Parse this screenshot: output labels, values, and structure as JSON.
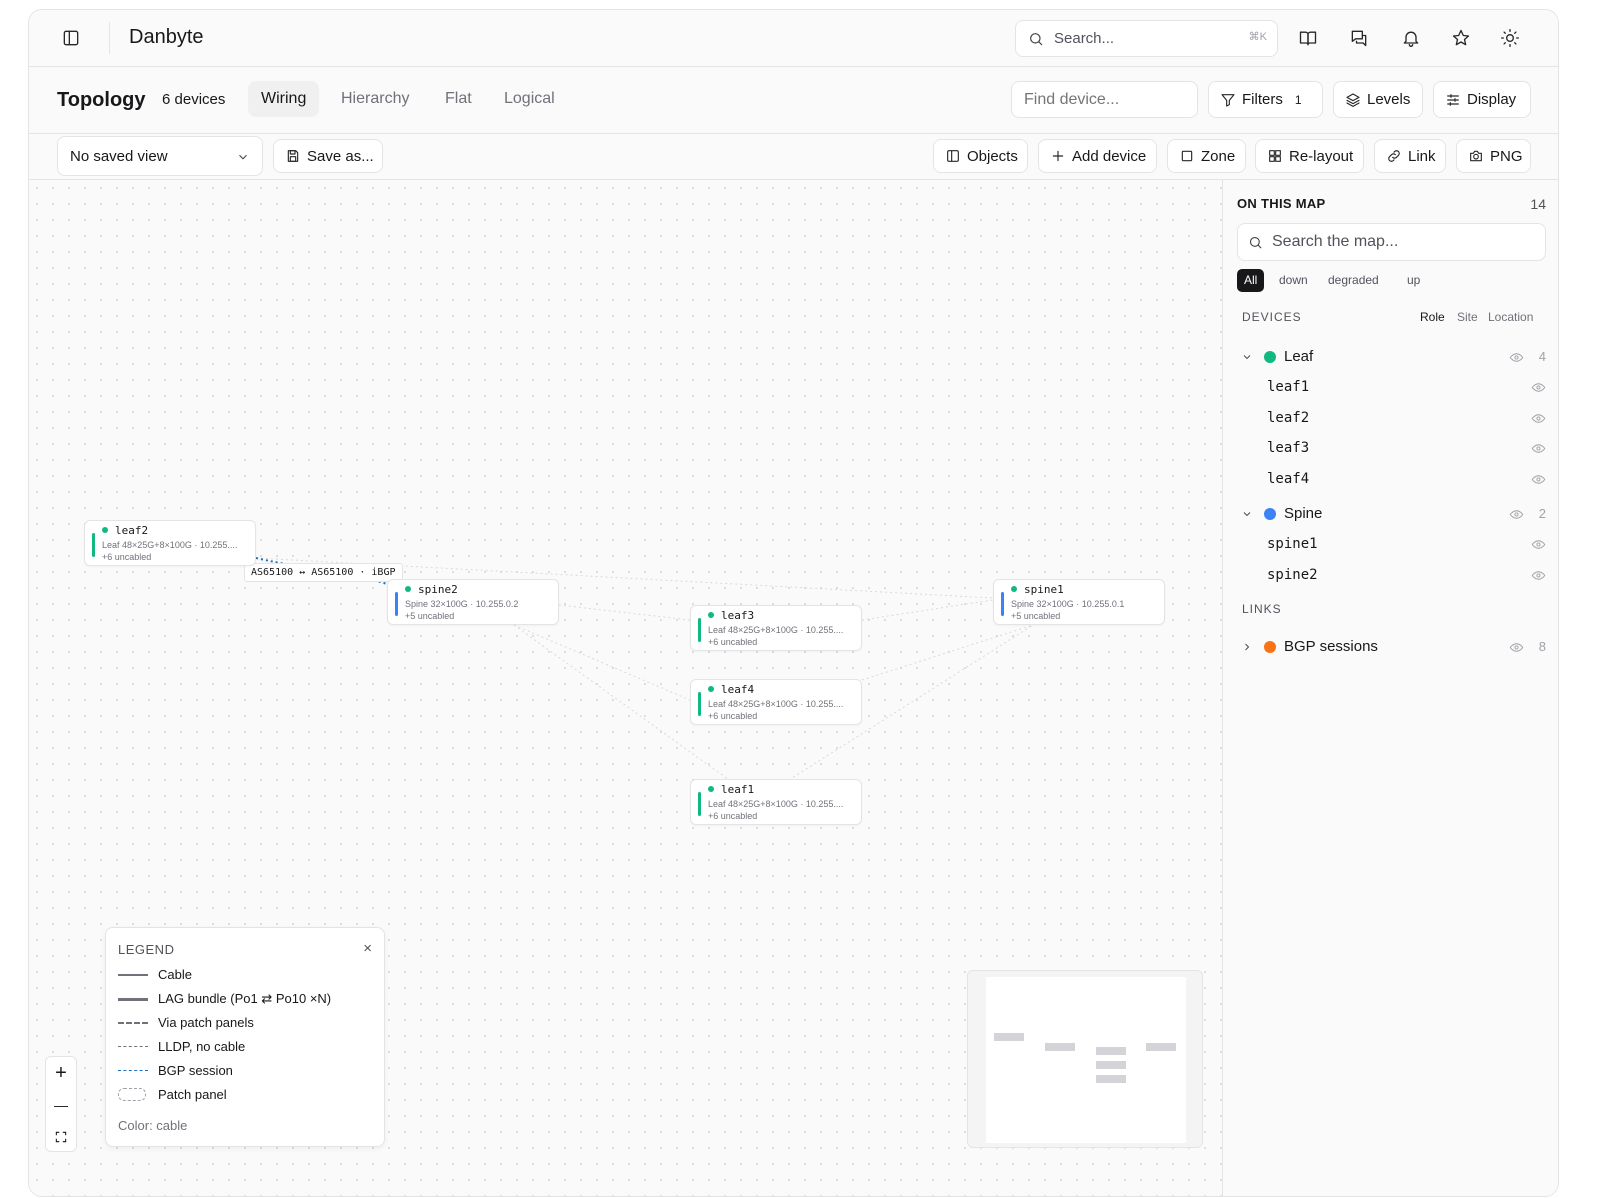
{
  "app": {
    "brand": "Danbyte"
  },
  "header": {
    "search_placeholder": "Search...",
    "search_shortcut": "⌘K",
    "icons": [
      "sidebar-toggle-icon",
      "book-icon",
      "chat-icon",
      "bell-icon",
      "star-icon",
      "sun-icon"
    ]
  },
  "page": {
    "title": "Topology",
    "device_count": "6 devices",
    "tabs": [
      "Wiring",
      "Hierarchy",
      "Flat",
      "Logical"
    ],
    "active_tab": "Wiring",
    "find_placeholder": "Find device...",
    "filters_label": "Filters",
    "filters_badge": "1",
    "levels_label": "Levels",
    "display_label": "Display"
  },
  "toolbar": {
    "saved_view": "No saved view",
    "save_as": "Save as...",
    "objects": "Objects",
    "add_device": "Add device",
    "zone": "Zone",
    "relayout": "Re-layout",
    "link": "Link",
    "png": "PNG"
  },
  "canvas": {
    "nodes": [
      {
        "id": "leaf2",
        "name": "leaf2",
        "sub": "Leaf 48×25G+8×100G · 10.255....",
        "uncabled": "+6 uncabled",
        "role": "leaf"
      },
      {
        "id": "spine2",
        "name": "spine2",
        "sub": "Spine 32×100G · 10.255.0.2",
        "uncabled": "+5 uncabled",
        "role": "spine"
      },
      {
        "id": "spine1",
        "name": "spine1",
        "sub": "Spine 32×100G · 10.255.0.1",
        "uncabled": "+5 uncabled",
        "role": "spine"
      },
      {
        "id": "leaf3",
        "name": "leaf3",
        "sub": "Leaf 48×25G+8×100G · 10.255....",
        "uncabled": "+6 uncabled",
        "role": "leaf"
      },
      {
        "id": "leaf4",
        "name": "leaf4",
        "sub": "Leaf 48×25G+8×100G · 10.255....",
        "uncabled": "+6 uncabled",
        "role": "leaf"
      },
      {
        "id": "leaf1",
        "name": "leaf1",
        "sub": "Leaf 48×25G+8×100G · 10.255....",
        "uncabled": "+6 uncabled",
        "role": "leaf"
      }
    ],
    "bgp_label": "AS65100 ↔ AS65100 · iBGP"
  },
  "legend": {
    "title": "LEGEND",
    "close": "×",
    "items": [
      "Cable",
      "LAG bundle (Po1 ⇄ Po10 ×N)",
      "Via patch panels",
      "LLDP, no cable",
      "BGP session",
      "Patch panel"
    ],
    "footer": "Color: cable"
  },
  "zoom": {
    "in": "+",
    "out": "—"
  },
  "panel": {
    "title": "ON THIS MAP",
    "count": "14",
    "search_placeholder": "Search the map...",
    "status_filters": [
      "All",
      "down",
      "degraded",
      "up"
    ],
    "devices_label": "DEVICES",
    "group_by": [
      "Role",
      "Site",
      "Location"
    ],
    "groups": [
      {
        "name": "Leaf",
        "count": "4",
        "color": "#10b981",
        "items": [
          "leaf1",
          "leaf2",
          "leaf3",
          "leaf4"
        ]
      },
      {
        "name": "Spine",
        "count": "2",
        "color": "#3b82f6",
        "items": [
          "spine1",
          "spine2"
        ]
      }
    ],
    "links_label": "LINKS",
    "link_groups": [
      {
        "name": "BGP sessions",
        "count": "8",
        "color": "#f97316"
      }
    ]
  },
  "colors": {
    "leaf": "#10b981",
    "spine": "#3b82f6",
    "bgp": "#f97316",
    "bgp_line": "#1e6fb8"
  }
}
